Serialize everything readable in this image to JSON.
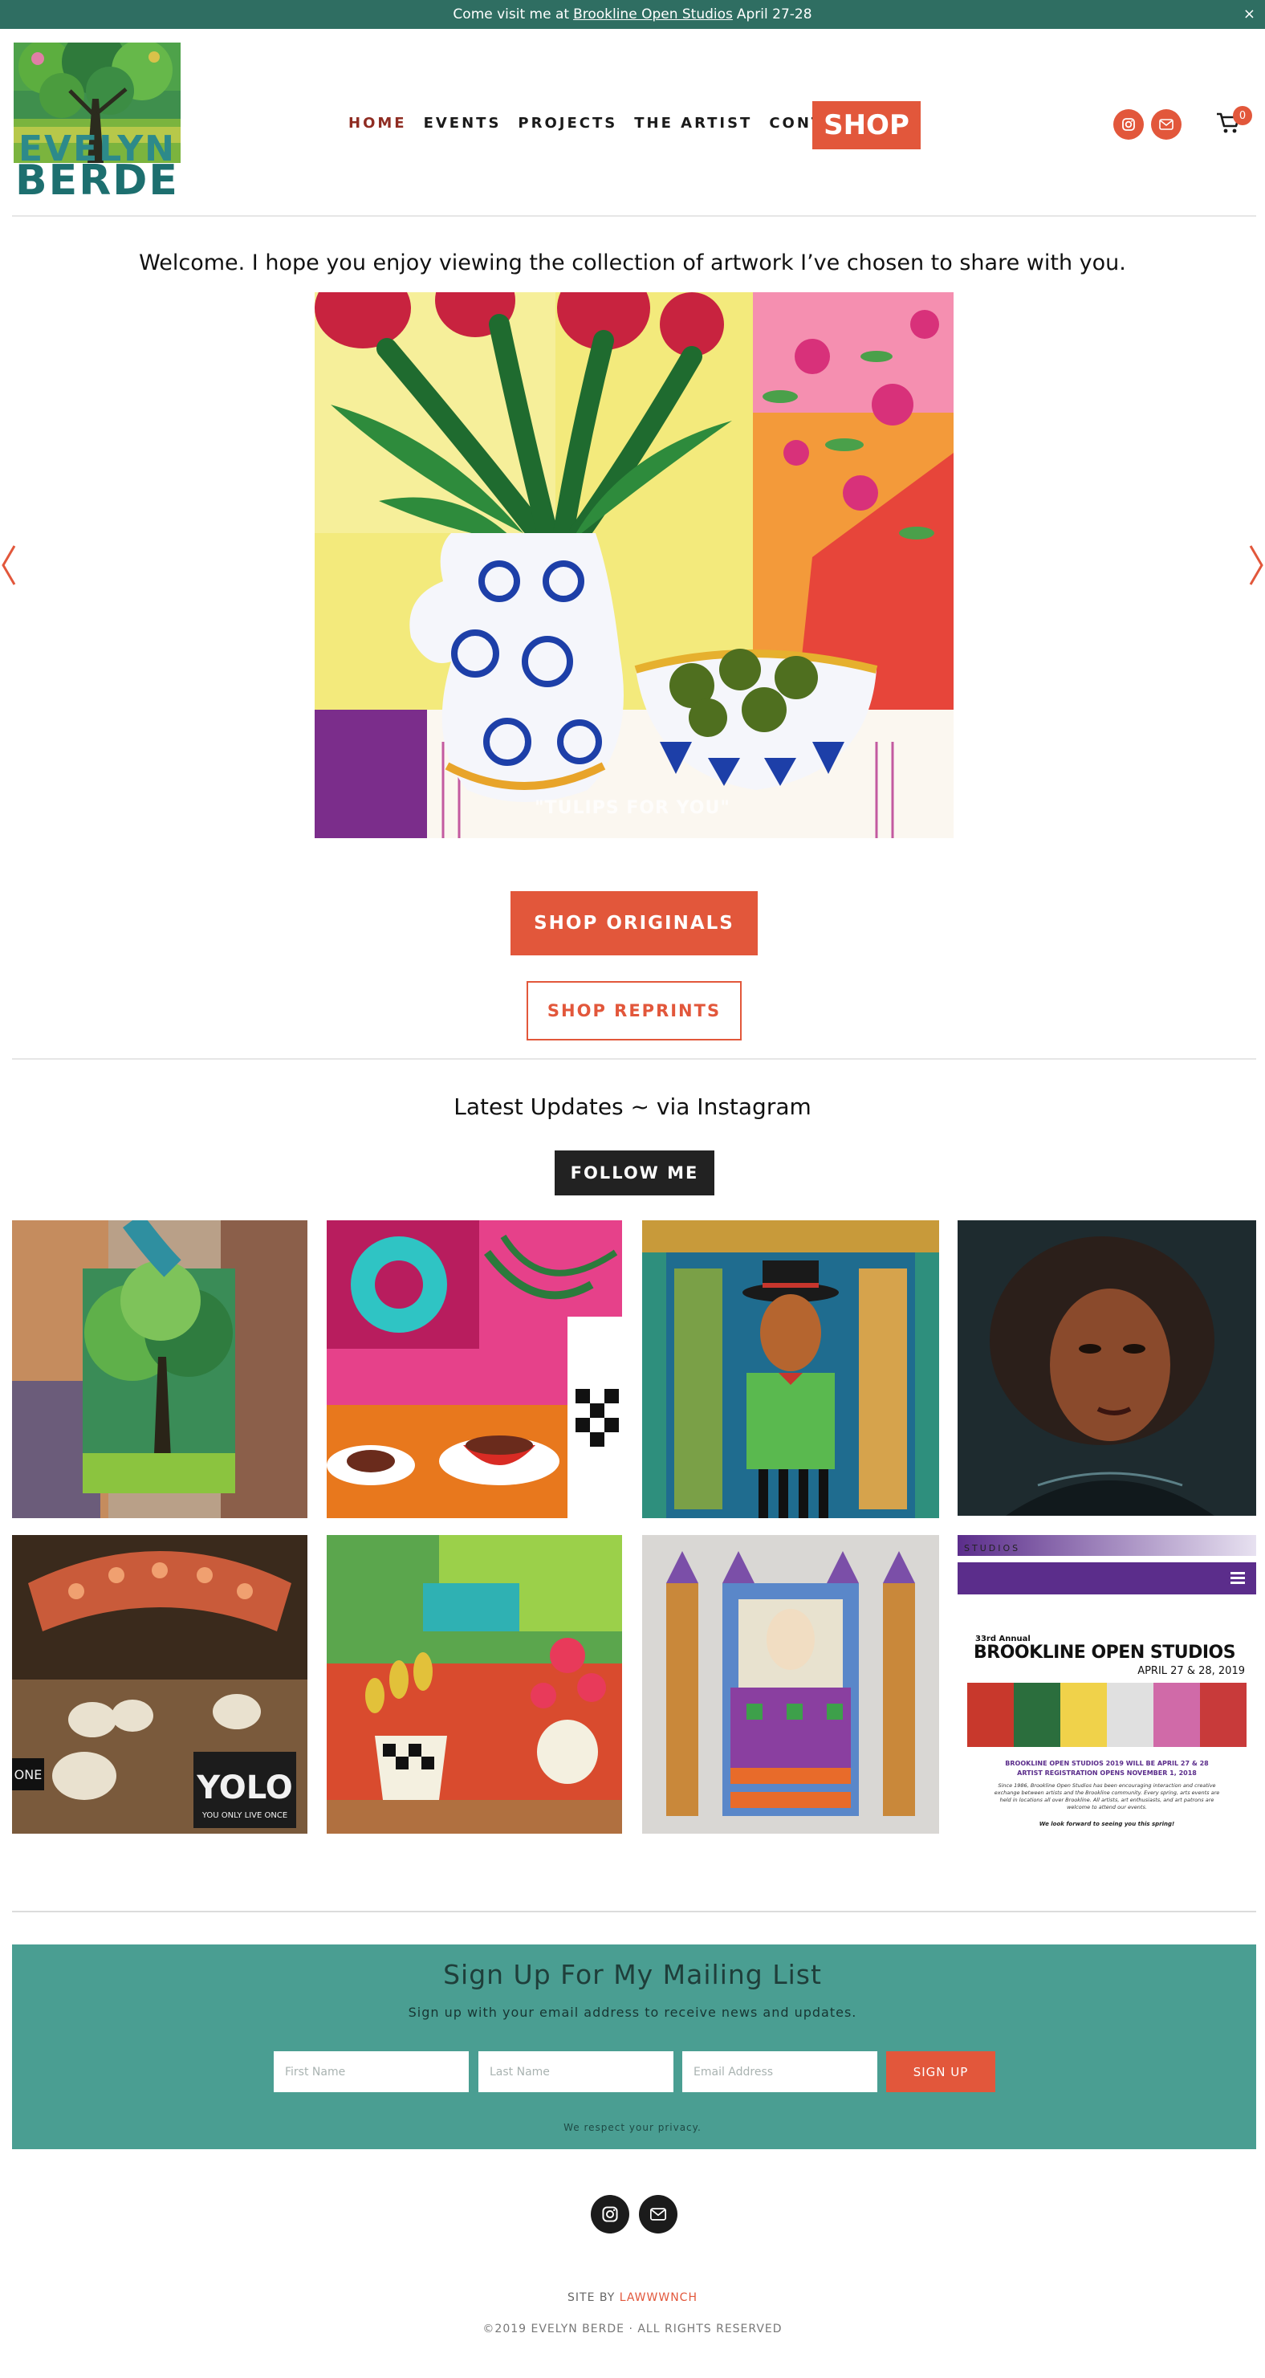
{
  "announcement": {
    "prefix": "Come visit me at",
    "link": "Brookline Open Studios",
    "suffix": "April 27-28",
    "close": "×"
  },
  "logo": {
    "line1": "EVELYN",
    "line2": "BERDE"
  },
  "nav": {
    "items": [
      {
        "label": "HOME",
        "active": true
      },
      {
        "label": "EVENTS"
      },
      {
        "label": "PROJECTS"
      },
      {
        "label": "THE ARTIST"
      },
      {
        "label": "CONTACT"
      }
    ],
    "shop": "SHOP",
    "cart_count": "0"
  },
  "welcome": "Welcome. I hope you enjoy viewing the collection of artwork I’ve chosen to share with you.",
  "hero": {
    "caption": "\"TULIPS FOR YOU\""
  },
  "buttons": {
    "shop_originals": "SHOP ORIGINALS",
    "shop_reprints": "SHOP REPRINTS"
  },
  "updates": {
    "title": "Latest Updates ~ via Instagram",
    "follow": "FOLLOW ME",
    "poster": {
      "brand": "STUDIOS",
      "annual": "33rd Annual",
      "title": "BROOKLINE OPEN STUDIOS",
      "dates": "APRIL 27 & 28, 2019",
      "line1": "BROOKLINE OPEN STUDIOS 2019 WILL BE APRIL 27 & 28",
      "line2": "ARTIST REGISTRATION OPENS NOVEMBER 1, 2018",
      "body": "Since 1986, Brookline Open Studios has been encouraging interaction and creative exchange between artists and the Brookline community. Every spring, arts events are held in locations all over Brookline. All artists, art enthusiasts, and art patrons are welcome to attend our events.",
      "closing": "We look forward to seeing you this spring!"
    },
    "yolo": "YOLO",
    "yolo_sub": "YOU ONLY LIVE ONCE",
    "sign_partial": "ONE"
  },
  "mailing": {
    "title": "Sign Up For My Mailing List",
    "subtitle": "Sign up with your email address to receive news and updates.",
    "first_name": "First Name",
    "last_name": "Last Name",
    "email": "Email Address",
    "submit": "SIGN UP",
    "privacy": "We respect your privacy."
  },
  "footer": {
    "site_by": "SITE BY",
    "site_by_link": "LAWWWNCH",
    "copyright": "©2019 EVELYN BERDE · ALL RIGHTS RESERVED"
  },
  "colors": {
    "teal_dark": "#2f6e62",
    "accent": "#e2573b",
    "mailing_bg": "#4a9e92"
  },
  "icons": [
    "close-icon",
    "instagram-icon",
    "email-icon",
    "cart-icon",
    "chevron-left-icon",
    "chevron-right-icon"
  ]
}
